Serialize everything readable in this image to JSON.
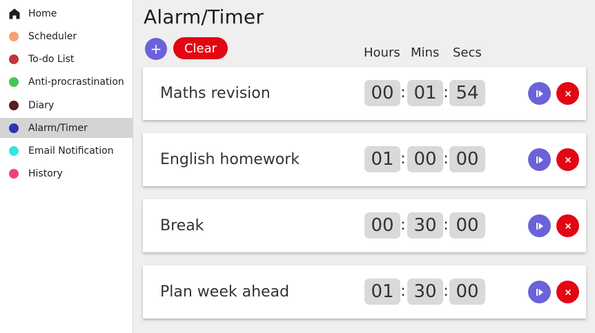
{
  "sidebar": {
    "items": [
      {
        "label": "Home",
        "icon": "home-icon",
        "color": "#1d1d1d"
      },
      {
        "label": "Scheduler",
        "icon": "dot",
        "color": "#f5a06e"
      },
      {
        "label": "To-do List",
        "icon": "dot",
        "color": "#c0353b"
      },
      {
        "label": "Anti-procrastination",
        "icon": "dot",
        "color": "#44c655"
      },
      {
        "label": "Diary",
        "icon": "dot",
        "color": "#5b1d1d"
      },
      {
        "label": "Alarm/Timer",
        "icon": "dot",
        "color": "#2f34b5",
        "active": true
      },
      {
        "label": "Email Notification",
        "icon": "dot",
        "color": "#33e6e0"
      },
      {
        "label": "History",
        "icon": "dot",
        "color": "#f0437a"
      }
    ]
  },
  "main": {
    "title": "Alarm/Timer",
    "add_label": "+",
    "clear_label": "Clear",
    "columns": {
      "hours": "Hours",
      "mins": "Mins",
      "secs": "Secs"
    },
    "timers": [
      {
        "name": "Maths revision",
        "hours": "00",
        "mins": "01",
        "secs": "54"
      },
      {
        "name": "English homework",
        "hours": "01",
        "mins": "00",
        "secs": "00"
      },
      {
        "name": "Break",
        "hours": "00",
        "mins": "30",
        "secs": "00"
      },
      {
        "name": "Plan week ahead",
        "hours": "01",
        "mins": "30",
        "secs": "00"
      }
    ],
    "separator": ":",
    "delete_symbol": "×"
  },
  "colors": {
    "accent": "#6a62d8",
    "danger": "#e30613",
    "background": "#efefef"
  }
}
